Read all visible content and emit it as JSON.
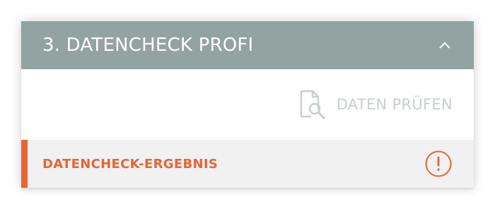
{
  "panel": {
    "title": "3. DATENCHECK PROFI",
    "collapse_icon": "chevron-up-icon",
    "action": {
      "label": "DATEN PRÜFEN",
      "icon": "document-search-icon"
    },
    "result": {
      "label": "DATENCHECK-ERGEBNIS",
      "icon": "exclamation-circle-icon"
    }
  },
  "colors": {
    "header_bg": "#93a3a1",
    "header_text": "#ffffff",
    "action_disabled": "#c9cfcd",
    "accent": "#ea6433",
    "result_bg": "#f1f1f1"
  }
}
